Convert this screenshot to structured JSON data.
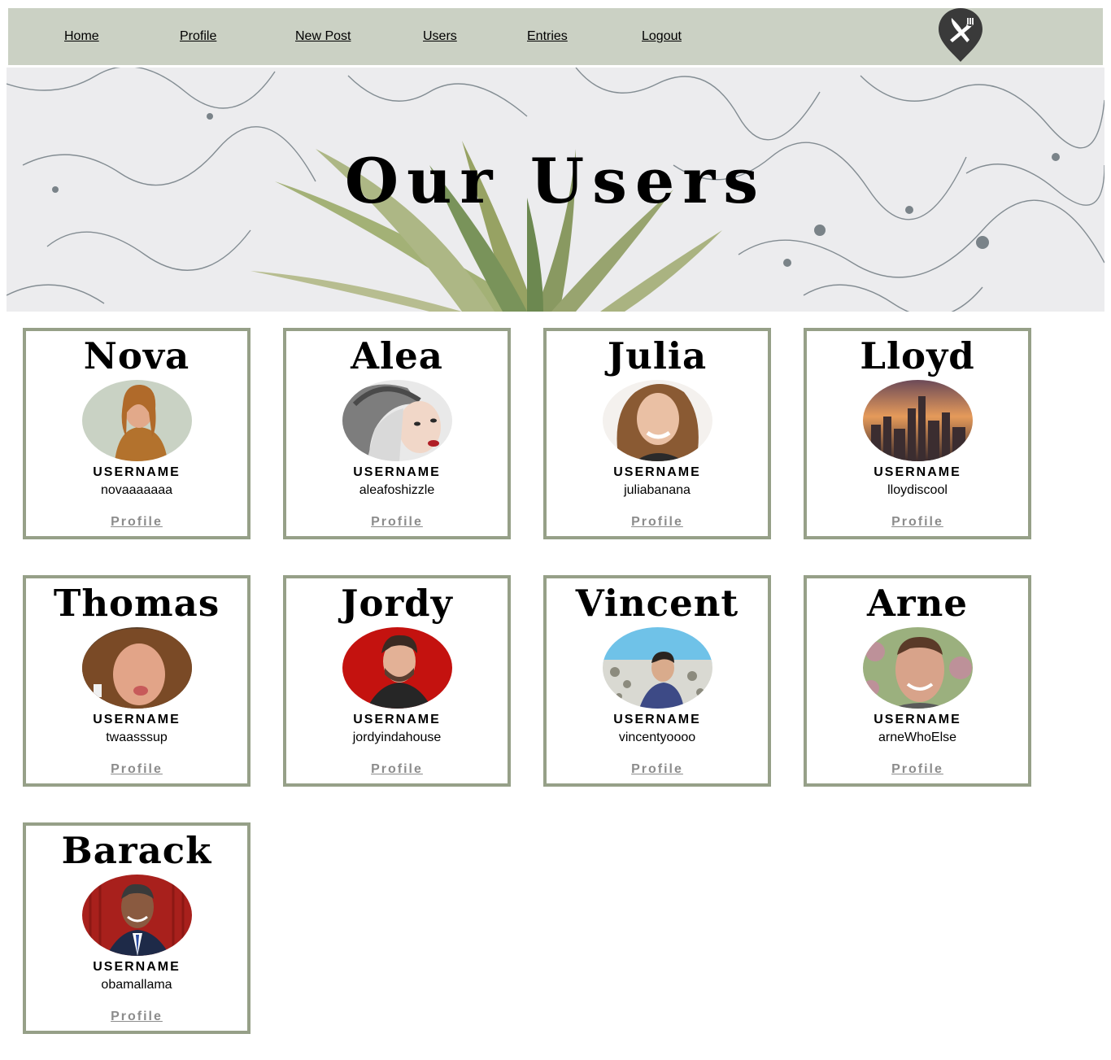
{
  "nav": {
    "items": [
      {
        "label": "Home"
      },
      {
        "label": "Profile"
      },
      {
        "label": "New Post"
      },
      {
        "label": "Users"
      },
      {
        "label": "Entries"
      },
      {
        "label": "Logout"
      }
    ],
    "logo_icon": "fork-knife-map-pin-icon",
    "background_color": "#cbd1c4"
  },
  "hero": {
    "title": "Our Users"
  },
  "card_border_color": "#96a088",
  "users": [
    {
      "name": "Nova",
      "label": "USERNAME",
      "username": "novaaaaaaa",
      "link": "Profile",
      "avatar_icon": "woman-portrait-avatar"
    },
    {
      "name": "Alea",
      "label": "USERNAME",
      "username": "aleafoshizzle",
      "link": "Profile",
      "avatar_icon": "woman-beanie-avatar"
    },
    {
      "name": "Julia",
      "label": "USERNAME",
      "username": "juliabanana",
      "link": "Profile",
      "avatar_icon": "woman-smiling-avatar"
    },
    {
      "name": "Lloyd",
      "label": "USERNAME",
      "username": "lloydiscool",
      "link": "Profile",
      "avatar_icon": "city-skyline-avatar"
    },
    {
      "name": "Thomas",
      "label": "USERNAME",
      "username": "twaasssup",
      "link": "Profile",
      "avatar_icon": "man-curly-hair-avatar"
    },
    {
      "name": "Jordy",
      "label": "USERNAME",
      "username": "jordyindahouse",
      "link": "Profile",
      "avatar_icon": "man-red-background-avatar"
    },
    {
      "name": "Vincent",
      "label": "USERNAME",
      "username": "vincentyoooo",
      "link": "Profile",
      "avatar_icon": "man-snowy-mountain-avatar"
    },
    {
      "name": "Arne",
      "label": "USERNAME",
      "username": "arneWhoElse",
      "link": "Profile",
      "avatar_icon": "man-smiling-avatar"
    },
    {
      "name": "Barack",
      "label": "USERNAME",
      "username": "obamallama",
      "link": "Profile",
      "avatar_icon": "man-suit-flags-avatar"
    }
  ]
}
